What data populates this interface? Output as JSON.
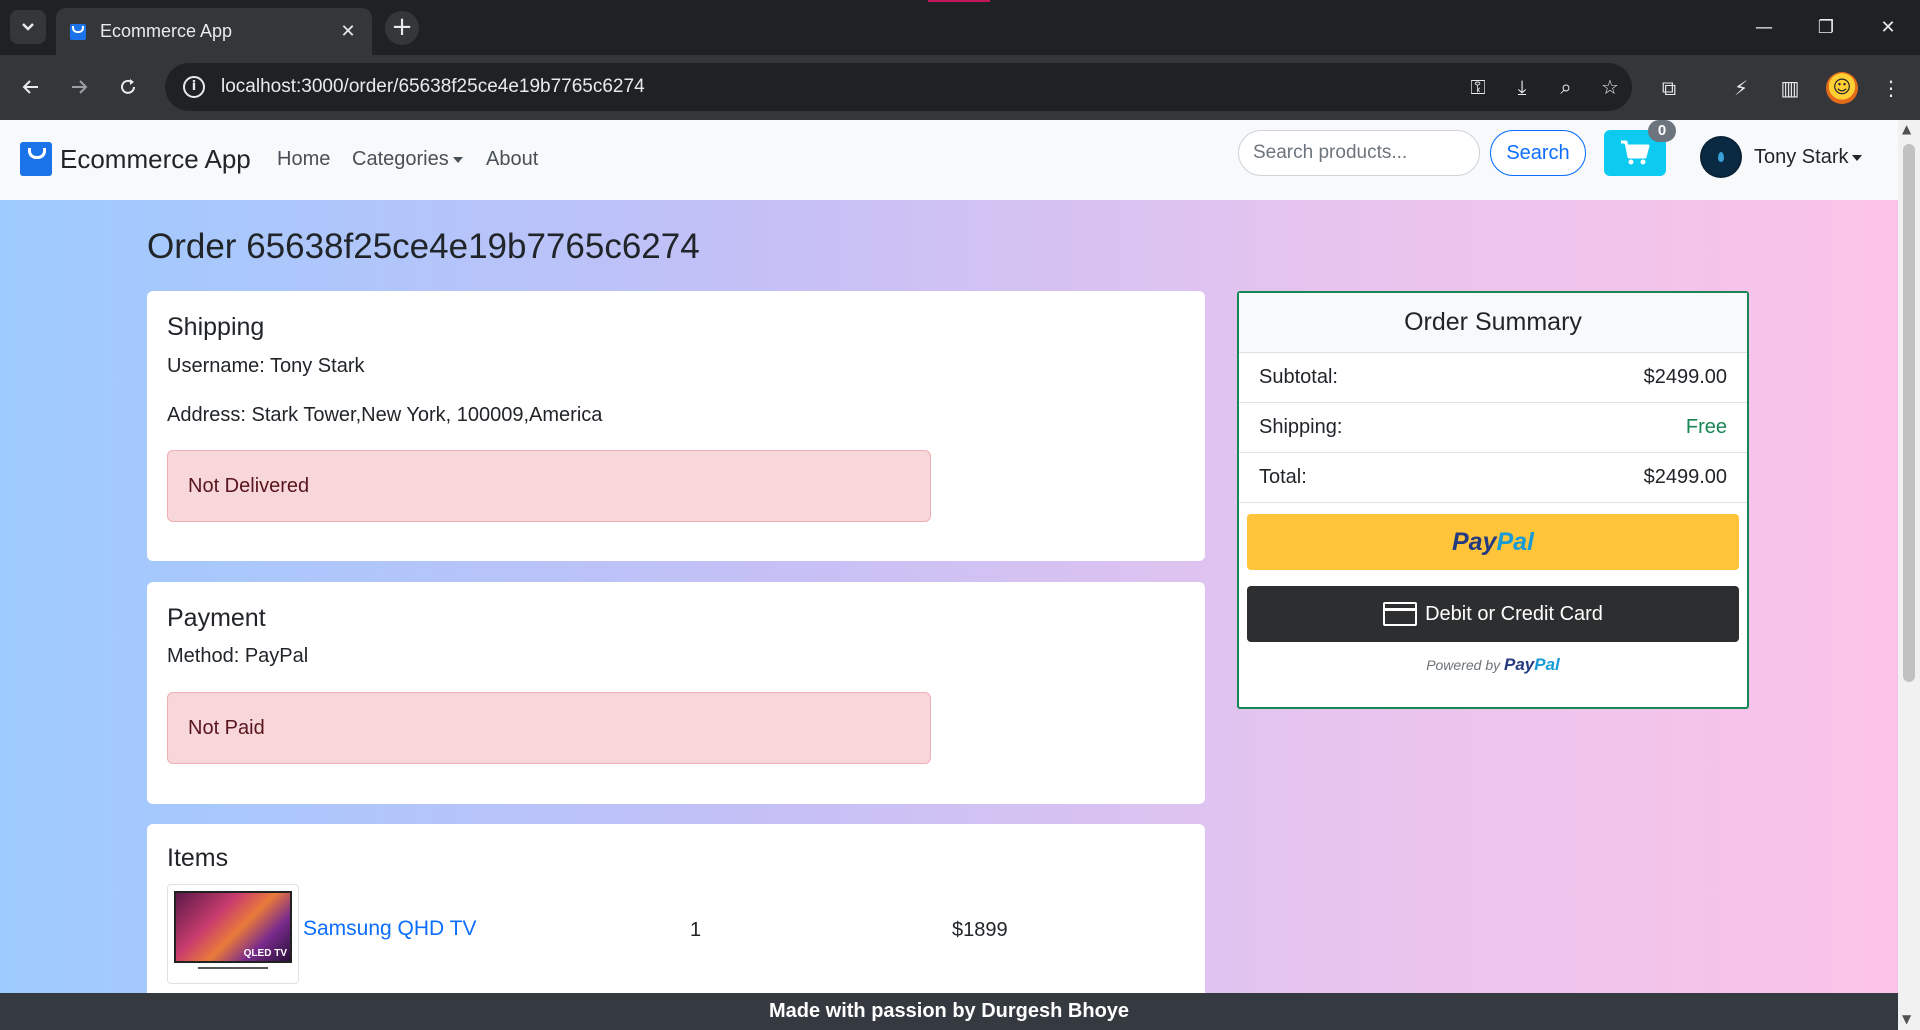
{
  "browser": {
    "tab_title": "Ecommerce App",
    "tab_close": "✕",
    "new_tab": "+",
    "url": "localhost:3000/order/65638f25ce4e19b7765c6274",
    "window_controls": {
      "minimize": "—",
      "restore": "❐",
      "close": "✕"
    },
    "icons": [
      "key-icon",
      "install-icon",
      "zoom-icon",
      "star-icon",
      "extensions-icon",
      "speed-icon",
      "sidepanel-icon",
      "profile-icon",
      "menu-icon"
    ]
  },
  "navbar": {
    "brand": "Ecommerce App",
    "links": {
      "home": "Home",
      "categories": "Categories",
      "about": "About"
    },
    "search_placeholder": "Search products...",
    "search_button": "Search",
    "cart_count": "0",
    "user_name": "Tony Stark"
  },
  "order": {
    "title": "Order 65638f25ce4e19b7765c6274",
    "shipping": {
      "heading": "Shipping",
      "username": "Username: Tony Stark",
      "address": "Address: Stark Tower,New York, 100009,America",
      "status": "Not Delivered"
    },
    "payment": {
      "heading": "Payment",
      "method": "Method: PayPal",
      "status": "Not Paid"
    },
    "items": {
      "heading": "Items",
      "list": [
        {
          "name": "Samsung QHD TV",
          "qty": "1",
          "price": "$1899",
          "thumb_label": "QLED TV"
        }
      ]
    }
  },
  "summary": {
    "heading": "Order Summary",
    "subtotal_label": "Subtotal:",
    "subtotal_value": "$2499.00",
    "shipping_label": "Shipping:",
    "shipping_value": "Free",
    "total_label": "Total:",
    "total_value": "$2499.00",
    "paypal_pay": "Pay",
    "paypal_pal": "Pal",
    "card_button": "Debit or Credit Card",
    "powered_by": "Powered by",
    "powered_pay": "Pay",
    "powered_pal": "Pal"
  },
  "footer": {
    "text": "Made with passion by   Durgesh Bhoye"
  },
  "colors": {
    "accent": "#0d6efd",
    "success": "#198754",
    "danger_bg": "#f8d7da",
    "paypal_yellow": "#ffc439",
    "cart": "#0dcaf0"
  }
}
